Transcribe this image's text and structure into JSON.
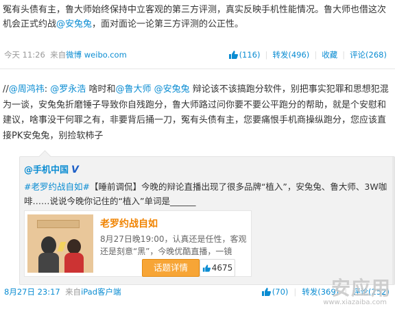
{
  "post1": {
    "text_parts": [
      "冤有头债有主，鲁大师始终保持中立客观的第三方评测，真实反映手机性能情况。鲁大师也借这次机会正式约战",
      "@安兔兔",
      "，面对面论一论第三方评测的公正性。"
    ],
    "time": "今天 11:26",
    "source_prefix": "来自",
    "source": "微博 weibo.com",
    "likes": "(116)",
    "repost": "转发(496)",
    "favorite": "收藏",
    "comment": "评论(268)"
  },
  "post2": {
    "segments": [
      {
        "t": "//",
        "link": false
      },
      {
        "t": "@周鸿祎",
        "link": true
      },
      {
        "t": ": ",
        "link": false
      },
      {
        "t": "@罗永浩",
        "link": true
      },
      {
        "t": " 啥时和",
        "link": false
      },
      {
        "t": "@鲁大师",
        "link": true
      },
      {
        "t": " ",
        "link": false
      },
      {
        "t": "@安兔兔",
        "link": true
      },
      {
        "t": " 辩论该不该搞跑分软件，别把事实犯罪和思想犯混为一谈，安兔兔折磨锤子导致你自残跑分，鲁大师路过问你要不要公平跑分的帮助，就是个安慰和建议，啥事没干何罪之有，非要背后捅一刀，冤有头债有主，您要痛恨手机商操纵跑分，您应该直接PK安兔兔，别捡软柿子",
        "link": false
      }
    ]
  },
  "card": {
    "author": "@手机中国",
    "verified": "V",
    "hashtag": "#老罗约战自如#",
    "text": "【睡前调侃】今晚的辩论直播出现了很多品牌“植入”，安兔兔、鲁大师、3W咖啡……说说今晚你记住的“植入”单词是______",
    "share_title": "老罗约战自如",
    "share_desc": "8月27日晚19:00，认真还是任性，客观还是刻意“黑”，今晚优酷直播，一镜",
    "detail_button": "话题详情",
    "count": "4675",
    "time": "8月27日 23:17",
    "source_prefix": "来自",
    "source": "iPad客户端",
    "likes": "(70)",
    "repost": "转发(369)",
    "comment": "评论(252)"
  },
  "watermark": {
    "mark": "安应用",
    "url": "www.xiazaiba.com"
  },
  "colors": {
    "link": "#0a8cd2",
    "accent": "#f7a536",
    "card_bg": "#f2f2f2"
  }
}
